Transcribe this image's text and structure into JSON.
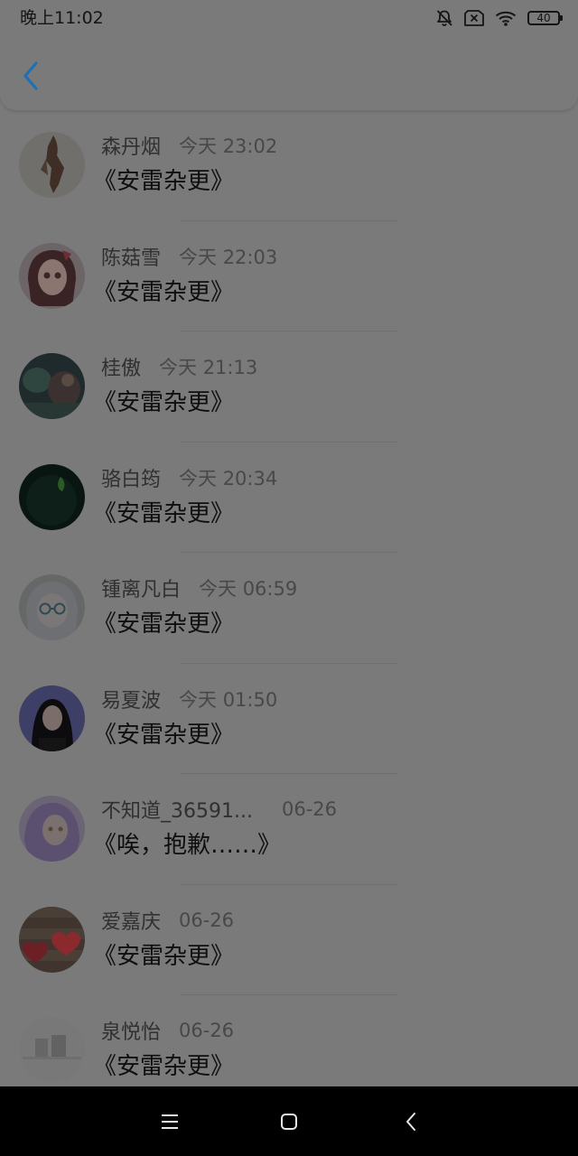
{
  "status_bar": {
    "time": "晚上11:02",
    "battery": "40",
    "icons": [
      "bell-off-icon",
      "sim-off-icon",
      "wifi-icon",
      "battery-icon"
    ]
  },
  "header": {
    "back_icon": "chevron-left-icon",
    "accent": "#1f6fb4"
  },
  "items": [
    {
      "name": "森丹烟",
      "time": "今天 23:02",
      "title": "《安雷杂更》"
    },
    {
      "name": "陈菇雪",
      "time": "今天 22:03",
      "title": "《安雷杂更》"
    },
    {
      "name": "桂傲",
      "time": "今天 21:13",
      "title": "《安雷杂更》"
    },
    {
      "name": "骆白筠",
      "time": "今天 20:34",
      "title": "《安雷杂更》"
    },
    {
      "name": "锺离凡白",
      "time": "今天 06:59",
      "title": "《安雷杂更》"
    },
    {
      "name": "易夏波",
      "time": "今天 01:50",
      "title": "《安雷杂更》"
    },
    {
      "name": "不知道_36591...",
      "time": "06-26",
      "title": "《唉，抱歉……》"
    },
    {
      "name": "爱嘉庆",
      "time": "06-26",
      "title": "《安雷杂更》"
    },
    {
      "name": "泉悦怡",
      "time": "06-26",
      "title": "《安雷杂更》"
    }
  ],
  "nav_bar": {
    "icons": [
      "menu-icon",
      "home-icon",
      "back-icon"
    ]
  }
}
